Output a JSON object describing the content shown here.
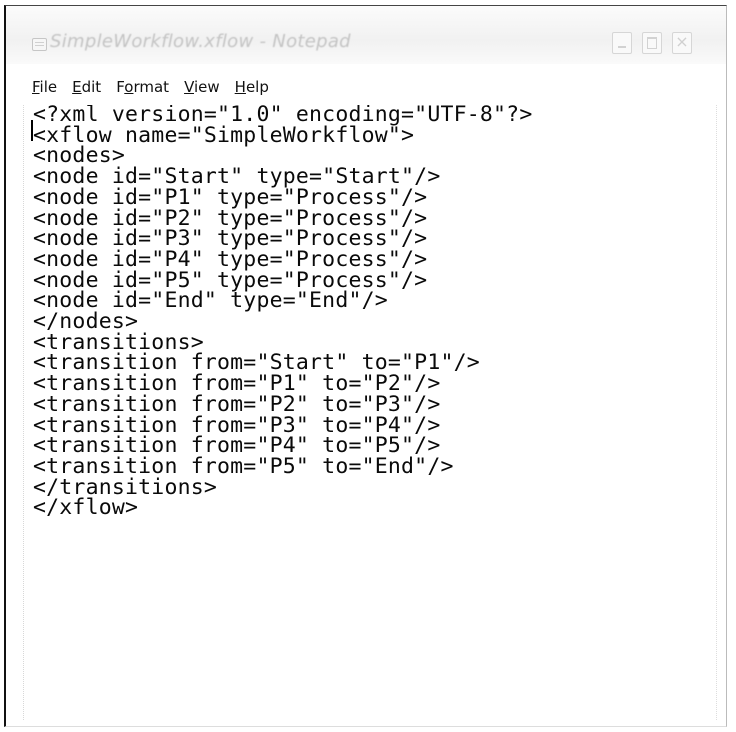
{
  "window": {
    "title": "SimpleWorkflow.xflow - Notepad"
  },
  "menu": {
    "file": {
      "acc": "F",
      "rest": "ile"
    },
    "edit": {
      "acc": "E",
      "rest": "dit"
    },
    "format": {
      "pre": "F",
      "acc": "o",
      "rest": "rmat"
    },
    "view": {
      "acc": "V",
      "rest": "iew"
    },
    "help": {
      "acc": "H",
      "rest": "elp"
    }
  },
  "document": {
    "lines": [
      "<?xml version=\"1.0\" encoding=\"UTF-8\"?>",
      "<xflow name=\"SimpleWorkflow\">",
      "<nodes>",
      "<node id=\"Start\" type=\"Start\"/>",
      "<node id=\"P1\" type=\"Process\"/>",
      "<node id=\"P2\" type=\"Process\"/>",
      "<node id=\"P3\" type=\"Process\"/>",
      "<node id=\"P4\" type=\"Process\"/>",
      "<node id=\"P5\" type=\"Process\"/>",
      "<node id=\"End\" type=\"End\"/>",
      "</nodes>",
      "<transitions>",
      "<transition from=\"Start\" to=\"P1\"/>",
      "<transition from=\"P1\" to=\"P2\"/>",
      "<transition from=\"P2\" to=\"P3\"/>",
      "<transition from=\"P3\" to=\"P4\"/>",
      "<transition from=\"P4\" to=\"P5\"/>",
      "<transition from=\"P5\" to=\"End\"/>",
      "</transitions>",
      "</xflow>"
    ]
  }
}
